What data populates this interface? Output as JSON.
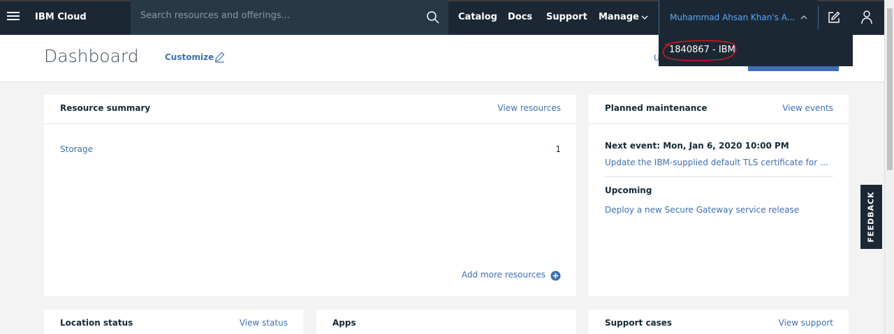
{
  "topbar": {
    "brand": "IBM Cloud",
    "search_placeholder": "Search resources and offerings...",
    "nav": [
      "Catalog",
      "Docs",
      "Support",
      "Manage"
    ],
    "account": "Muhammad Ahsan Khan's A..."
  },
  "account_menu": {
    "items": [
      "1840867 - IBM"
    ],
    "annotation_color": "#d4141e"
  },
  "header": {
    "title": "Dashboard",
    "customize": "Customize",
    "partial_text": "U"
  },
  "cards": {
    "resource_summary": {
      "title": "Resource summary",
      "link": "View resources",
      "rows": [
        {
          "name": "Storage",
          "count": "1"
        }
      ],
      "add_more": "Add more resources"
    },
    "planned_maintenance": {
      "title": "Planned maintenance",
      "link": "View events",
      "next_event": "Next event: Mon, Jan 6, 2020 10:00 PM",
      "event_desc": "Update the IBM-supplied default TLS certificate for q...",
      "upcoming_label": "Upcoming",
      "upcoming_items": [
        "Deploy a new Secure Gateway service release"
      ]
    },
    "location_status": {
      "title": "Location status",
      "link": "View status"
    },
    "apps": {
      "title": "Apps"
    },
    "support_cases": {
      "title": "Support cases",
      "link": "View support"
    }
  },
  "feedback": "FEEDBACK",
  "colors": {
    "topbar": "#1b2834",
    "link": "#3d70b2",
    "account_text": "#5aaafa"
  }
}
